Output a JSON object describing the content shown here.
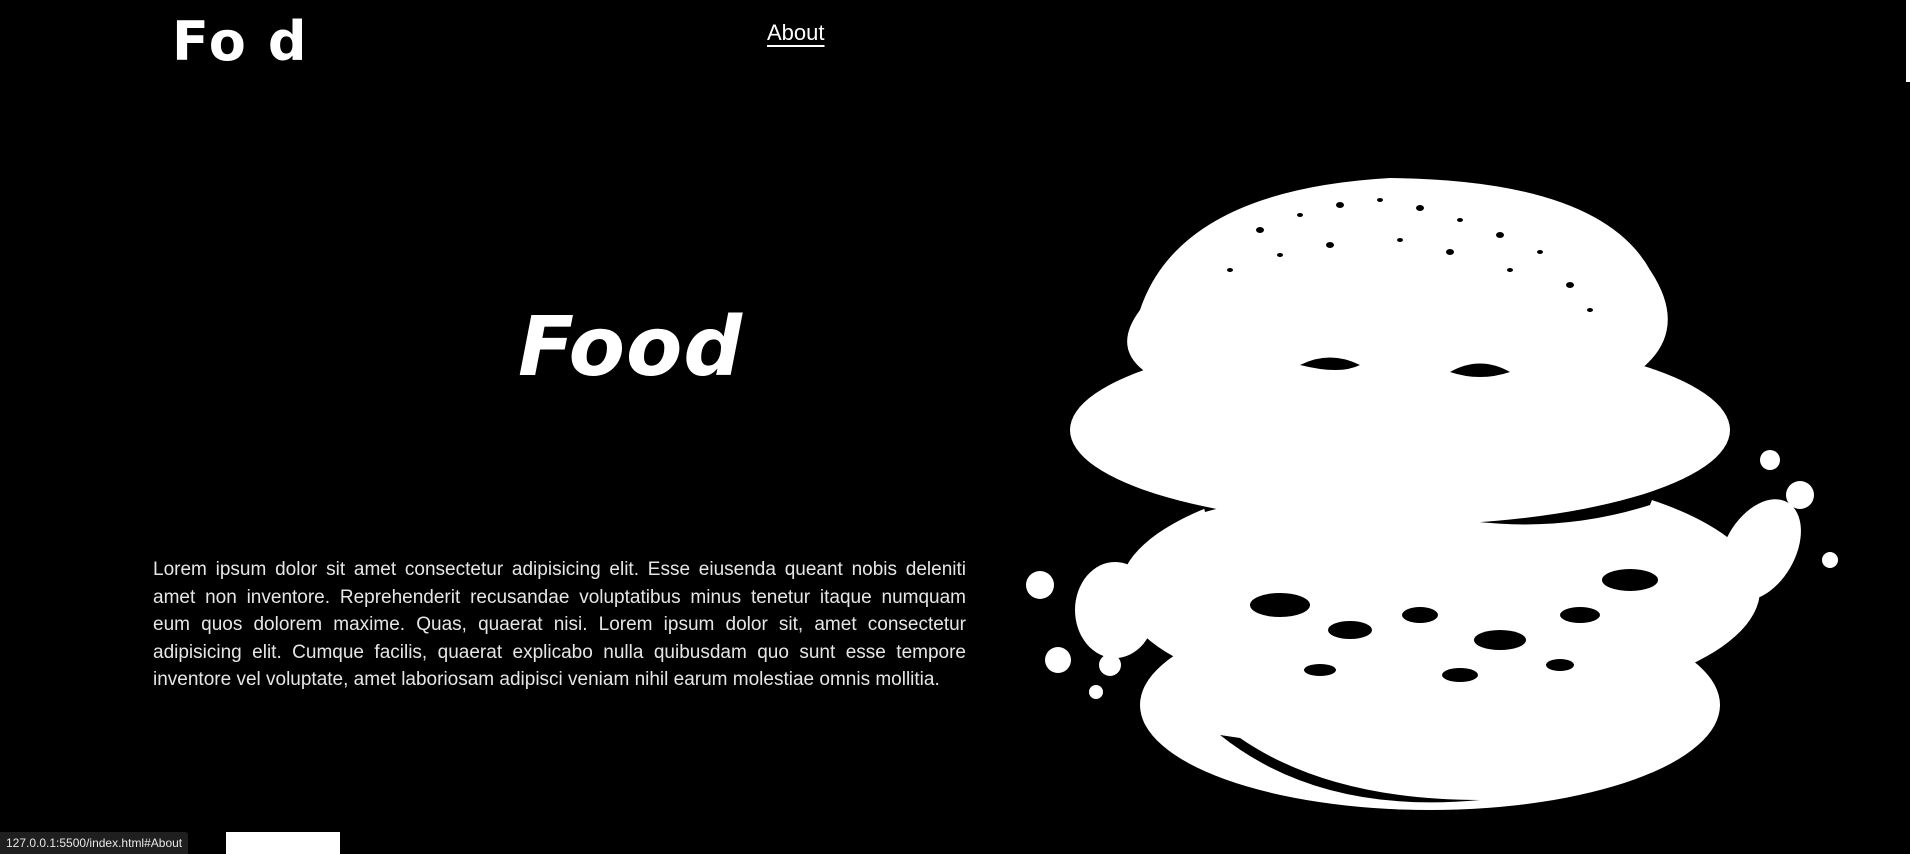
{
  "header": {
    "logo_left": "Fo",
    "logo_right": "d",
    "nav_about": "About"
  },
  "hero": {
    "title": "Food",
    "body": "Lorem ipsum dolor sit amet consectetur adipisicing elit. Esse eiusenda queant nobis deleniti amet non inventore. Reprehenderit recusandae voluptatibus minus tenetur itaque numquam eum quos dolorem maxime. Quas, quaerat nisi. Lorem ipsum dolor sit, amet consectetur adipisicing elit. Cumque facilis, quaerat explicabo nulla quibusdam quo sunt esse tempore inventore vel voluptate, amet laboriosam adipisci veniam nihil earum molestiae omnis mollitia.",
    "image_icon": "burger-image"
  },
  "statusbar": {
    "url": "127.0.0.1:5500/index.html#About"
  },
  "colors": {
    "background": "#000000",
    "foreground": "#ffffff"
  }
}
